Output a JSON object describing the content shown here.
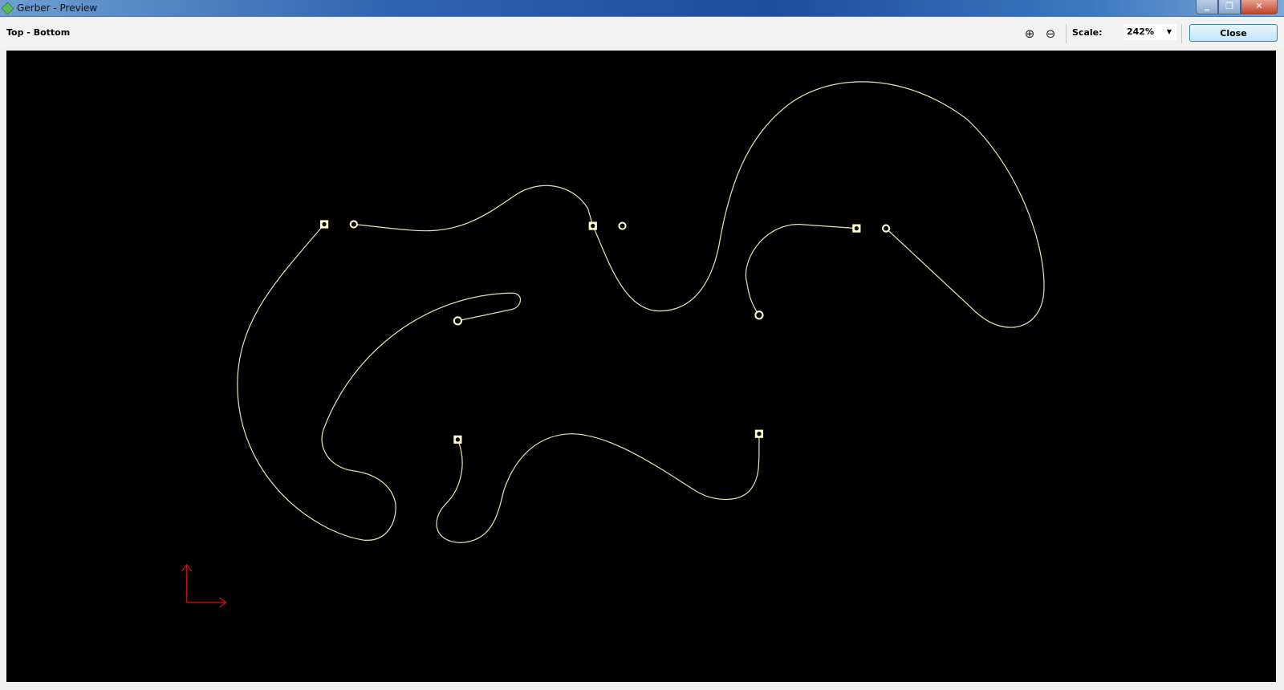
{
  "window": {
    "title": "Gerber - Preview",
    "minimize": "‗",
    "restore": "❐",
    "close": "✕"
  },
  "toolbar": {
    "layer_label": "Top - Bottom",
    "zoom_in": "⊕",
    "zoom_out": "⊖",
    "scale_label": "Scale:",
    "scale_value": "242%",
    "scale_arrow": "▼",
    "close_label": "Close"
  },
  "colors": {
    "trace": "#e6e2b4",
    "pad": "#ffffc8",
    "axis": "#d01010",
    "background": "#000000"
  }
}
